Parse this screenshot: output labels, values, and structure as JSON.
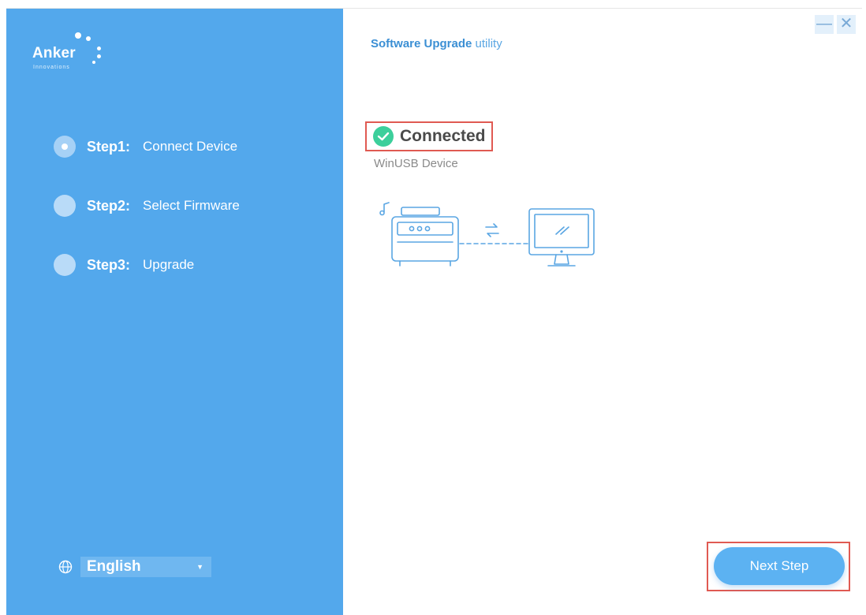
{
  "brand": {
    "name": "Anker",
    "tagline": "Innovations"
  },
  "header": {
    "title_strong": "Software Upgrade",
    "title_light": "utility",
    "minimize_glyph": "—",
    "close_glyph": "✕"
  },
  "steps": [
    {
      "number": "Step1:",
      "label": "Connect Device",
      "state": "active"
    },
    {
      "number": "Step2:",
      "label": "Select Firmware",
      "state": "pending"
    },
    {
      "number": "Step3:",
      "label": "Upgrade",
      "state": "pending"
    }
  ],
  "language": {
    "selected": "English",
    "icon": "globe-icon",
    "caret": "▼"
  },
  "status": {
    "text": "Connected",
    "device": "WinUSB Device",
    "icon": "check-circle-icon"
  },
  "actions": {
    "next_label": "Next Step"
  },
  "colors": {
    "sidebar": "#53a8ec",
    "accent": "#3b8fd4",
    "success": "#3ccf9b",
    "highlight_border": "#e05a52",
    "button": "#5cb2f2"
  }
}
